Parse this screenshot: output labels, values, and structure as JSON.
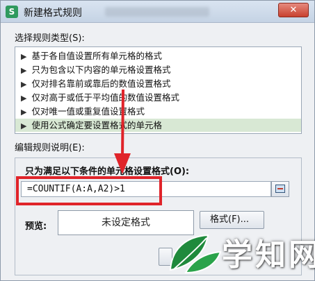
{
  "window": {
    "title": "新建格式规则",
    "app_icon_glyph": "S",
    "close_glyph": "✕"
  },
  "rule_type": {
    "label": "选择规则类型(S):",
    "items": [
      {
        "label": "基于各自值设置所有单元格的格式"
      },
      {
        "label": "只为包含以下内容的单元格设置格式"
      },
      {
        "label": "仅对排名靠前或靠后的数值设置格式"
      },
      {
        "label": "仅对高于或低于平均值的数值设置格式"
      },
      {
        "label": "仅对唯一值或重复值设置格式"
      },
      {
        "label": "使用公式确定要设置格式的单元格",
        "selected": true
      }
    ],
    "arrow_glyph": "▶"
  },
  "description": {
    "label": "编辑规则说明(E):",
    "condition_title": "只为满足以下条件的单元格设置格式(O):",
    "formula_value": "=COUNTIF(A:A,A2)>1"
  },
  "preview": {
    "label": "预览:",
    "text": "未设定格式",
    "format_button": "格式(F)..."
  },
  "watermark": {
    "text": "学知网"
  },
  "colors": {
    "highlight": "#e0242a",
    "selected_row": "#d8e8d4",
    "watermark_green": "#1f8a3c"
  }
}
